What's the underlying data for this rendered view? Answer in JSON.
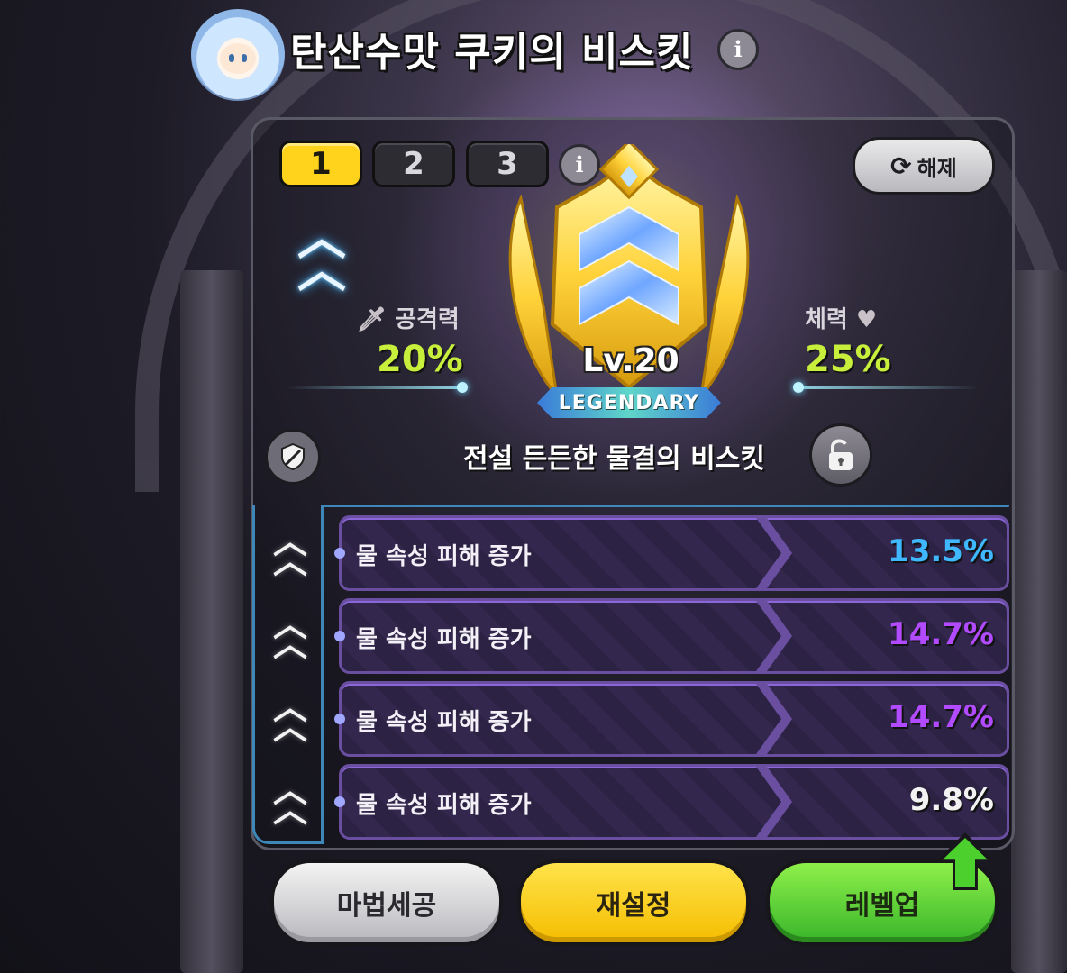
{
  "header": {
    "title": "탄산수맛 쿠키의 비스킷",
    "info_glyph": "i",
    "avatar_icon": "soda-cookie-avatar-icon"
  },
  "tabs": [
    {
      "label": "1",
      "active": true
    },
    {
      "label": "2",
      "active": false
    },
    {
      "label": "3",
      "active": false
    }
  ],
  "tabs_info_glyph": "i",
  "unequip_button": {
    "label": "해제",
    "icon": "refresh-icon"
  },
  "biscuit": {
    "level": "Lv.20",
    "grade": "LEGENDARY",
    "rank_icon": "double-chevron-rank-icon",
    "set_name": "전설 든든한 물결의 비스킷",
    "locked": false
  },
  "stats": {
    "attack": {
      "label": "공격력",
      "value": "20%",
      "icon": "sword-icon"
    },
    "hp": {
      "label": "체력",
      "value": "25%",
      "icon": "heart-icon"
    }
  },
  "substats": [
    {
      "name": "물 속성 피해 증가",
      "value": "13.5%",
      "color": "#3fb8ff"
    },
    {
      "name": "물 속성 피해 증가",
      "value": "14.7%",
      "color": "#b24bff"
    },
    {
      "name": "물 속성 피해 증가",
      "value": "14.7%",
      "color": "#b24bff"
    },
    {
      "name": "물 속성 피해 증가",
      "value": "9.8%",
      "color": "#f2f2f2"
    }
  ],
  "buttons": {
    "magic_craft": "마법세공",
    "reset": "재설정",
    "level_up": "레벨업"
  },
  "colors": {
    "accent_yellow": "#ffd21c",
    "stat_green": "#c8ef3c",
    "panel_border": "#5a5a66",
    "substat_border": "#6a4fa0",
    "rail_blue": "#3d88b8"
  }
}
